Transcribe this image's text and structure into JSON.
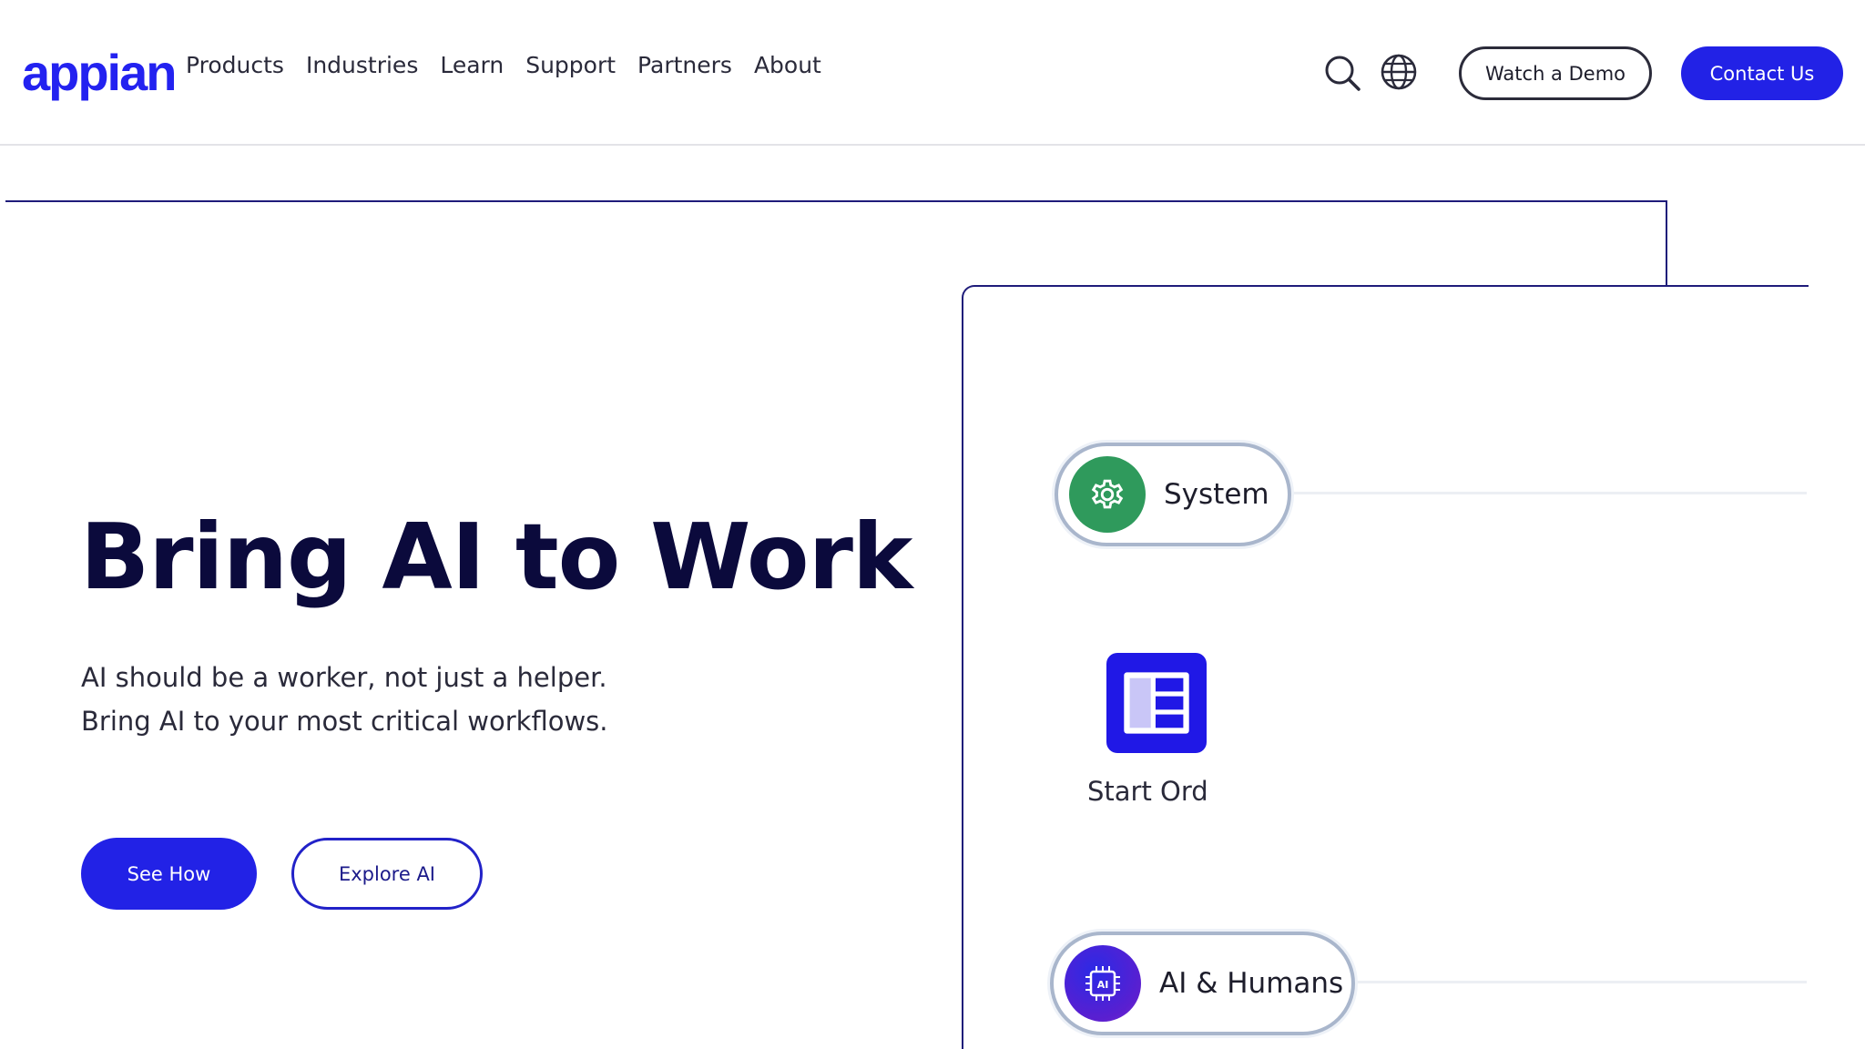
{
  "header": {
    "logo": "appian",
    "nav": [
      "Products",
      "Industries",
      "Learn",
      "Support",
      "Partners",
      "About"
    ],
    "search_icon": "search-icon",
    "globe_icon": "globe-icon",
    "watch_demo_label": "Watch a Demo",
    "contact_label": "Contact Us"
  },
  "hero": {
    "title": "Bring AI to Work",
    "subtitle_line1": "AI should be a worker, not just a helper.",
    "subtitle_line2": "Bring AI to your most critical workflows.",
    "see_how_label": "See How",
    "explore_label": "Explore AI"
  },
  "workflow": {
    "system_label": "System",
    "system_icon": "gear-icon",
    "system_color": "#2f9a5c",
    "start_label": "Start Ord",
    "start_icon": "form-layout-icon",
    "start_color": "#2018e6",
    "ai_label": "AI & Humans",
    "ai_icon": "ai-chip-icon",
    "ai_color": "#3a1fd8"
  },
  "colors": {
    "brand_blue": "#2222e6",
    "navy_text": "#0b0a3c",
    "line_navy": "#1f1c7a"
  }
}
